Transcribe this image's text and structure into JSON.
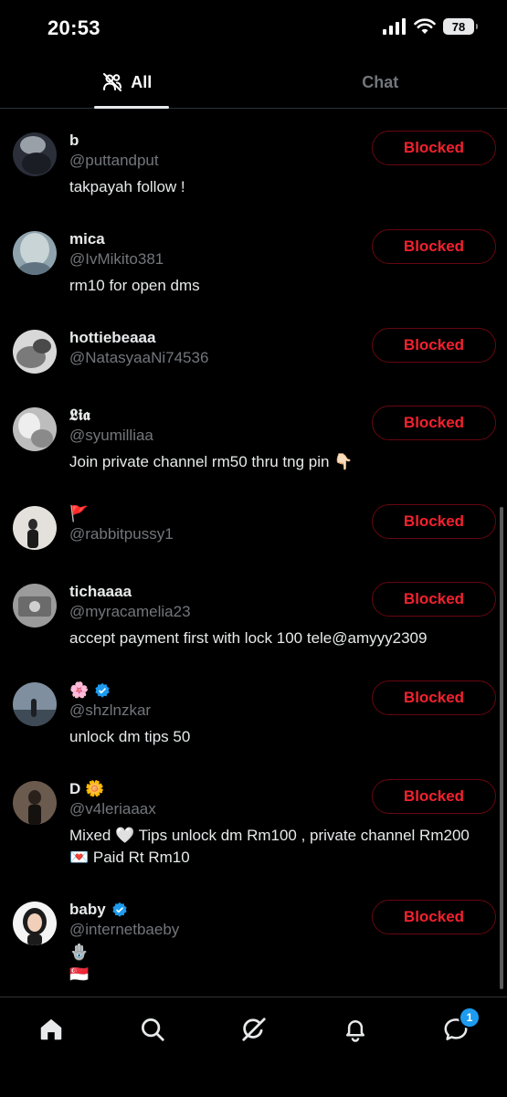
{
  "status": {
    "time": "20:53",
    "battery": "78"
  },
  "tabs": [
    {
      "label": "All",
      "active": true
    },
    {
      "label": "Chat",
      "active": false
    }
  ],
  "users": [
    {
      "name": "b",
      "handle": "@puttandput",
      "bio": "takpayah follow !",
      "button": "Blocked"
    },
    {
      "name": "mica",
      "handle": "@IvMikito381",
      "bio": "rm10 for open dms",
      "button": "Blocked"
    },
    {
      "name": "hottiebeaaa",
      "handle": "@NatasyaaNi74536",
      "bio": "",
      "button": "Blocked"
    },
    {
      "name": "𝕷𝖎𝖆",
      "handle": "@syumilliaa",
      "bio": "Join private channel rm50 thru tng pin 👇🏻",
      "button": "Blocked"
    },
    {
      "name": "🚩",
      "handle": "@rabbitpussy1",
      "bio": "",
      "button": "Blocked"
    },
    {
      "name": "tichaaaa",
      "handle": "@myracamelia23",
      "bio": "accept payment first with lock 100 tele@amyyy2309",
      "button": "Blocked"
    },
    {
      "name": "🌸",
      "handle": "@shzlnzkar",
      "bio": "unlock dm tips 50",
      "button": "Blocked",
      "verified": true
    },
    {
      "name": "D 🌼",
      "handle": "@v4leriaaax",
      "bio": "Mixed 🤍 Tips unlock dm Rm100 , private channel Rm200 💌 Paid Rt Rm10",
      "button": "Blocked"
    },
    {
      "name": "baby",
      "handle": "@internetbaeby",
      "bio": "🪬",
      "bio2": "🇸🇬",
      "button": "Blocked",
      "verified": true
    }
  ],
  "nav": {
    "items": [
      "home-icon",
      "search-icon",
      "grok-icon",
      "notifications-icon",
      "messages-icon"
    ],
    "messages_badge": "1"
  },
  "colors": {
    "accent": "#1d9bf0",
    "blocked_text": "#f4212e",
    "blocked_border": "#67070f"
  }
}
